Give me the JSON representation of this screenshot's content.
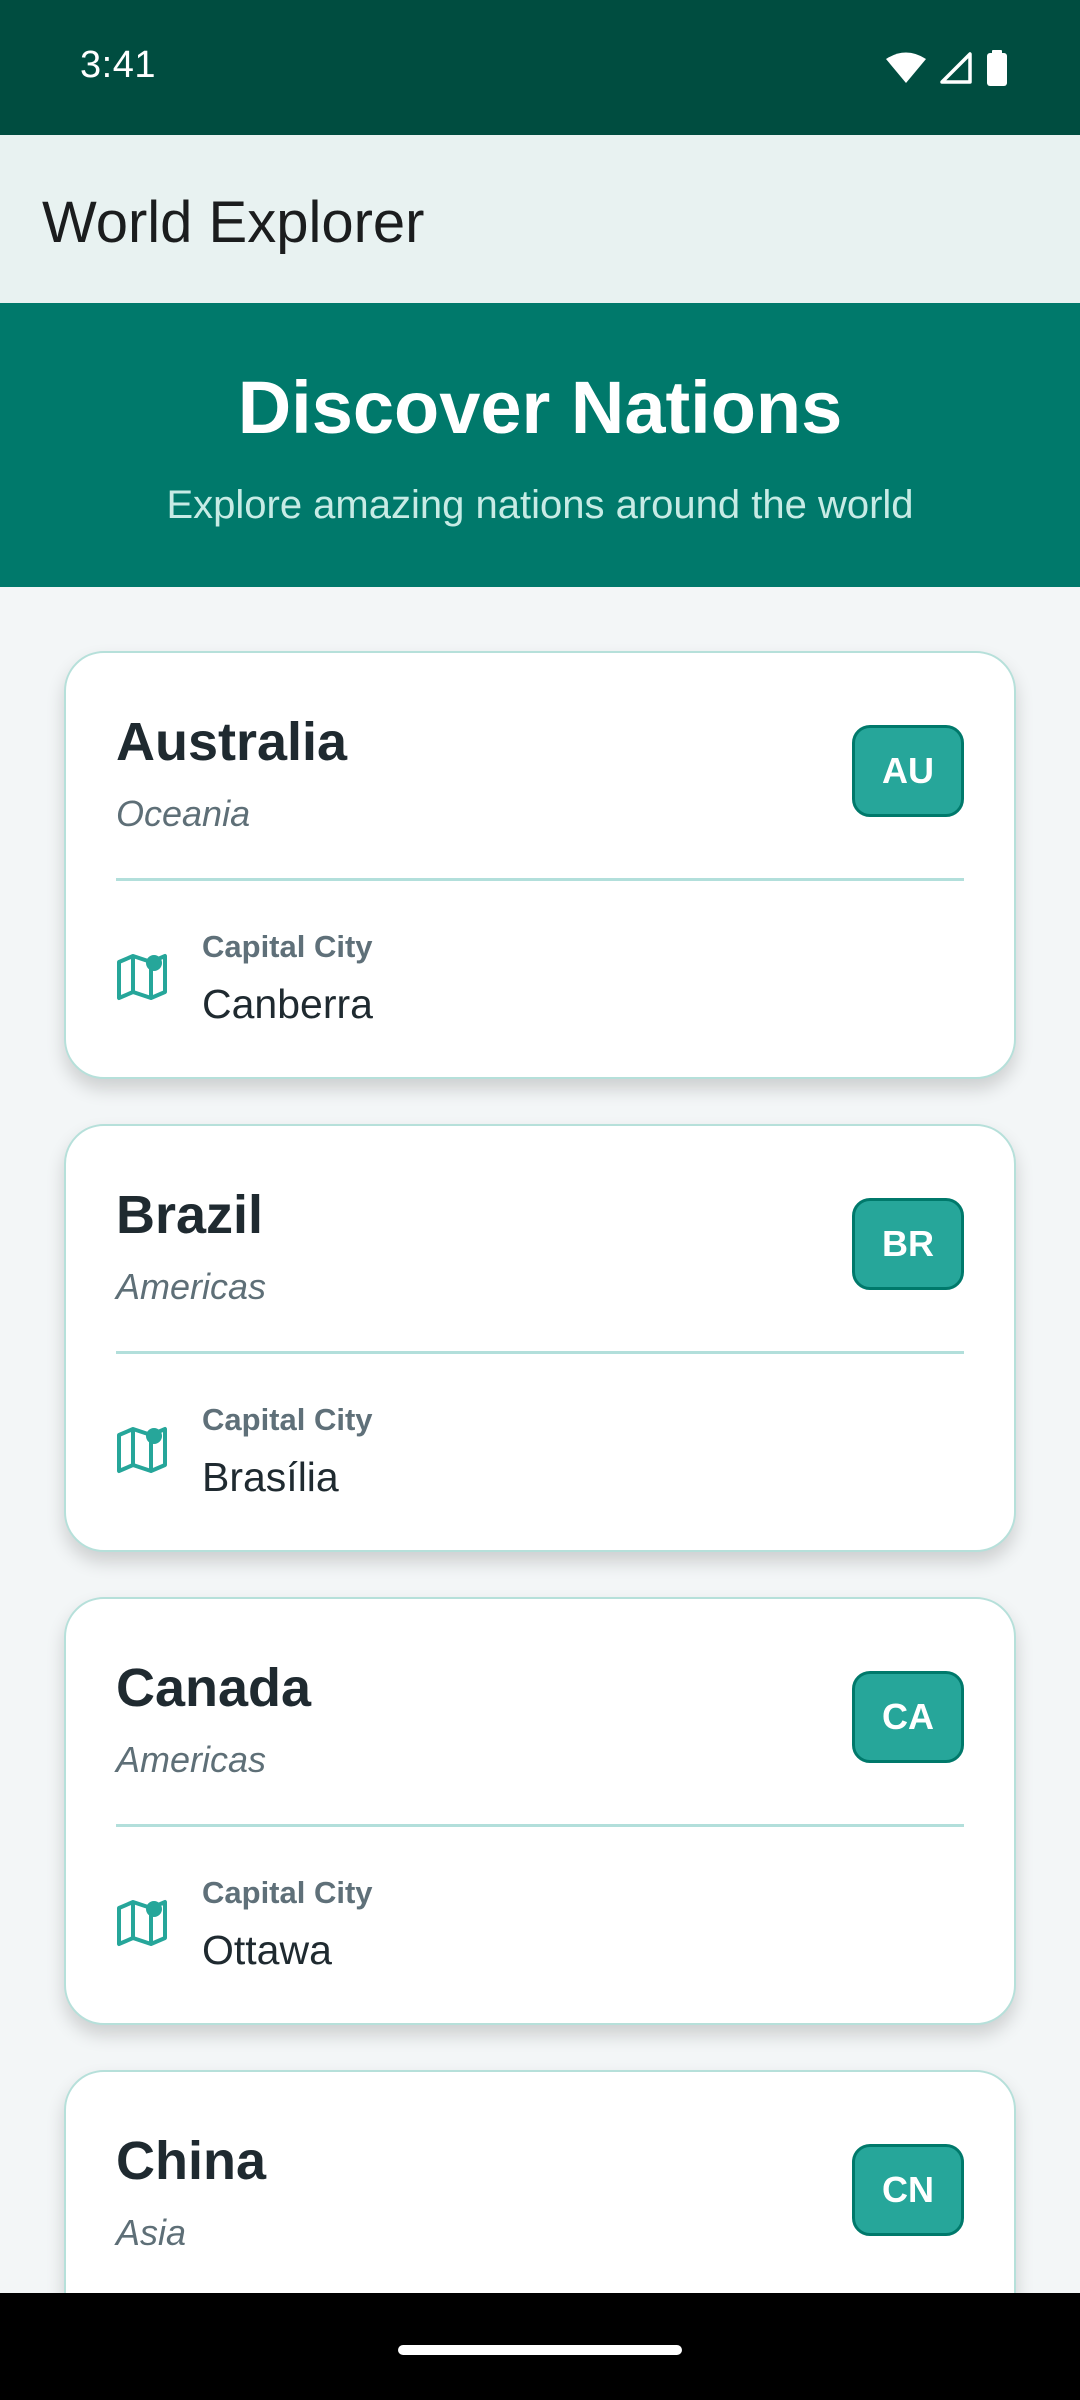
{
  "status_bar": {
    "time": "3:41"
  },
  "app_bar": {
    "title": "World Explorer"
  },
  "hero": {
    "title": "Discover Nations",
    "subtitle": "Explore amazing nations around the world"
  },
  "capital_label": "Capital City",
  "countries": [
    {
      "name": "Australia",
      "region": "Oceania",
      "code": "AU",
      "capital": "Canberra"
    },
    {
      "name": "Brazil",
      "region": "Americas",
      "code": "BR",
      "capital": "Brasília"
    },
    {
      "name": "Canada",
      "region": "Americas",
      "code": "CA",
      "capital": "Ottawa"
    },
    {
      "name": "China",
      "region": "Asia",
      "code": "CN"
    }
  ],
  "colors": {
    "status_bar": "#004d40",
    "hero": "#00796b",
    "badge": "#26a69a",
    "accent": "#26a69a"
  },
  "icons": [
    "wifi-icon",
    "signal-icon",
    "battery-icon",
    "map-icon"
  ]
}
